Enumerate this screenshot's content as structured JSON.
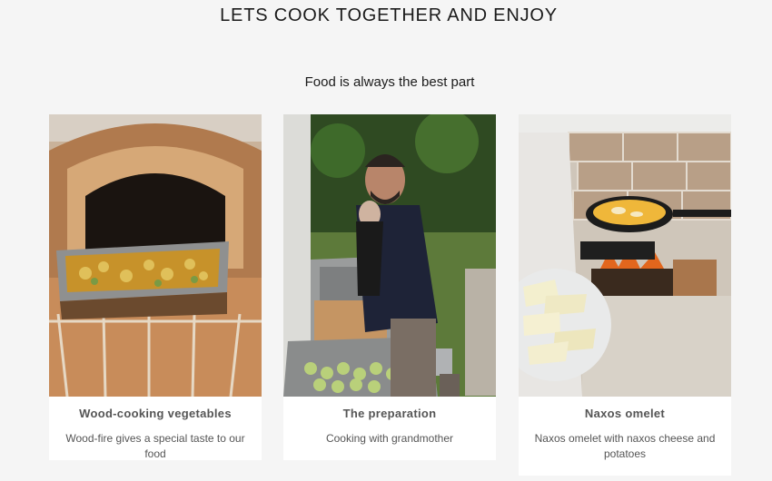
{
  "header": {
    "title": "LETS COOK TOGETHER AND ENJOY",
    "subtitle": "Food is always the best part"
  },
  "cards": [
    {
      "title": "Wood-cooking vegetables",
      "description": "Wood-fire gives a special taste to our food",
      "image": "wood-oven-vegetables-photo"
    },
    {
      "title": "The preparation",
      "description": "Cooking with grandmother",
      "image": "kitchen-preparation-photo"
    },
    {
      "title": "Naxos omelet",
      "description": "Naxos omelet with naxos cheese and potatoes",
      "image": "outdoor-omelet-photo"
    }
  ]
}
